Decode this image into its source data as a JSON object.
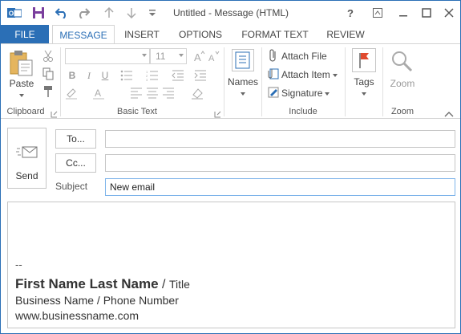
{
  "window": {
    "title": "Untitled - Message (HTML)",
    "help": "?",
    "accent_color": "#2b6fb6"
  },
  "quick_access": {
    "icons": [
      "save-icon",
      "undo-icon",
      "redo-icon",
      "up-arrow-icon",
      "down-arrow-icon",
      "customize-icon"
    ]
  },
  "tabs": [
    {
      "label": "FILE"
    },
    {
      "label": "MESSAGE"
    },
    {
      "label": "INSERT"
    },
    {
      "label": "OPTIONS"
    },
    {
      "label": "FORMAT TEXT"
    },
    {
      "label": "REVIEW"
    }
  ],
  "ribbon": {
    "clipboard": {
      "paste_label": "Paste",
      "group_label": "Clipboard"
    },
    "basic_text": {
      "font_size": "11",
      "bold": "B",
      "italic": "I",
      "underline": "U",
      "group_label": "Basic Text"
    },
    "names": {
      "label": "Names"
    },
    "include": {
      "attach_file": "Attach File",
      "attach_item": "Attach Item",
      "signature": "Signature",
      "group_label": "Include"
    },
    "tags": {
      "label": "Tags"
    },
    "zoom": {
      "label": "Zoom",
      "group_label": "Zoom"
    }
  },
  "compose": {
    "send_label": "Send",
    "to_label": "To...",
    "cc_label": "Cc...",
    "subject_label": "Subject",
    "to_value": "",
    "cc_value": "",
    "subject_value": "New email"
  },
  "signature": {
    "dashes": "--",
    "name": "First Name Last Name",
    "separator": "/",
    "title": "Title",
    "business_line": "Business Name / Phone Number",
    "website": "www.businessname.com"
  }
}
